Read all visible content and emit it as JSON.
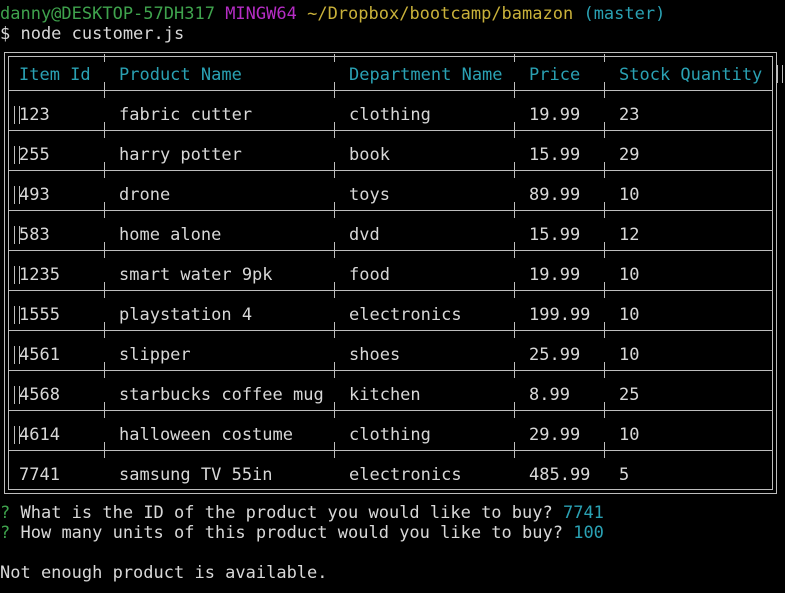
{
  "prompt": {
    "user_host": "danny@DESKTOP-57DH317",
    "env": "MINGW64",
    "path": "~/Dropbox/bootcamp/bamazon",
    "branch": "(master)",
    "command": "$ node customer.js"
  },
  "table": {
    "columns": [
      "Item Id",
      "Product Name",
      "Department Name",
      "Price",
      "Stock Quantity"
    ],
    "rows": [
      [
        "123",
        "fabric cutter",
        "clothing",
        "19.99",
        "23"
      ],
      [
        "255",
        "harry potter",
        "book",
        "15.99",
        "29"
      ],
      [
        "493",
        "drone",
        "toys",
        "89.99",
        "10"
      ],
      [
        "583",
        "home alone",
        "dvd",
        "15.99",
        "12"
      ],
      [
        "1235",
        "smart water 9pk",
        "food",
        "19.99",
        "10"
      ],
      [
        "1555",
        "playstation 4",
        "electronics",
        "199.99",
        "10"
      ],
      [
        "4561",
        "slipper",
        "shoes",
        "25.99",
        "10"
      ],
      [
        "4568",
        "starbucks coffee mug",
        "kitchen",
        "8.99",
        "25"
      ],
      [
        "4614",
        "halloween costume",
        "clothing",
        "29.99",
        "10"
      ],
      [
        "7741",
        "samsung TV 55in",
        "electronics",
        "485.99",
        "5"
      ]
    ]
  },
  "questions": [
    {
      "mark": "?",
      "text": "What is the ID of the product you would like to buy?",
      "answer": "7741"
    },
    {
      "mark": "?",
      "text": "How many units of this product would you like to buy?",
      "answer": "100"
    }
  ],
  "message": "Not enough product is available."
}
